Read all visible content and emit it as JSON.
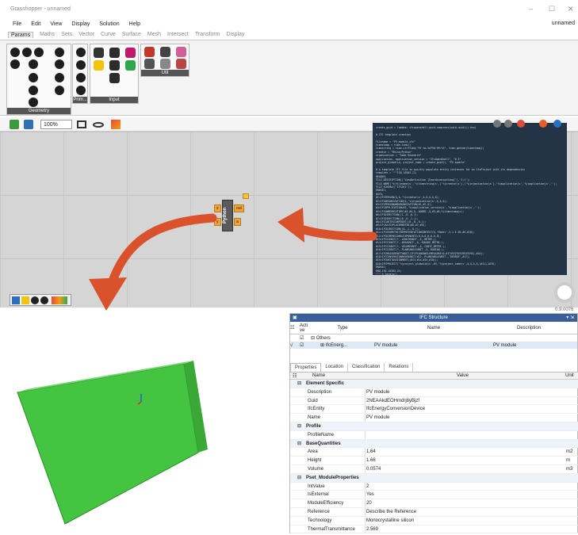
{
  "window": {
    "title": "Grasshopper - unnamed",
    "doc_name": "unnamed",
    "controls": [
      "–",
      "☐",
      "✕"
    ]
  },
  "menu": [
    "File",
    "Edit",
    "View",
    "Display",
    "Solution",
    "Help"
  ],
  "tabs": [
    "Params",
    "Maths",
    "Sets",
    "Vector",
    "Curve",
    "Surface",
    "Mesh",
    "Intersect",
    "Transform",
    "Display"
  ],
  "ribbon_groups": {
    "geometry": "Geometry",
    "primitive": "Prim...",
    "input": "Input",
    "util": "Util"
  },
  "canvas_toolbar": {
    "zoom": "100%"
  },
  "python_component": {
    "title": "Python",
    "inputs": [
      "x",
      "y"
    ],
    "outputs": [
      "out",
      "a"
    ]
  },
  "code_lines": [
    "create_guid = lambda: ifcopenshell.guid.compress(uuid.uuid1().hex)",
    "",
    "# IFC template creation",
    "",
    "filename = \"PV_module.ifc\"",
    "timestamp = time.time()",
    "timestring = time.strftime(\"%Y-%m-%dT%H:%M:%S\", time.gmtime(timestamp))",
    "creator = \"Rhino/Python\"",
    "organization = \"Some Research\"",
    "application, application_version = \"IfcOpenShell\", \"0.5\"",
    "project_globalid, project_name = create_guid(), \"PV module\"",
    "",
    "# A template IFC file to quickly populate entity instances for an IfcProject with its dependencies",
    "template = \"\"\"ISO-10303-21;",
    "HEADER;",
    "FILE_DESCRIPTION(('ViewDefinition [CoordinationView]'),'2;1');",
    "FILE_NAME('%(filename)s','%(timestring)s',('%(creator)s'),('%(organization)s'),'%(application)s','%(application)s','');",
    "FILE_SCHEMA(('IFC4X1'));",
    "ENDSEC;",
    "DATA;",
    "#1=IFCPERSON($,$,'%(creator)s',$,$,$,$,$);",
    "#2=IFCORGANIZATION($,'%(organization)s',$,$,$);",
    "#3=IFCPERSONANDORGANIZATION(#1,#2,$);",
    "#4=IFCAPPLICATION(#2,'%(application_version)s','%(application)s','');",
    "#5=IFCOWNERHISTORY(#3,#4,$,.ADDED.,$,#3,#4,%(timestamp)s);",
    "#6=IFCDIRECTION((1.,0.,0.));",
    "#7=IFCDIRECTION((0.,0.,1.));",
    "#8=IFCCARTESIANPOINT((0.,0.,0.));",
    "#9=IFCAXIS2PLACEMENT3D(#8,#7,#6);",
    "#10=IFCDIRECTION((0.,1.,0.));",
    "#11=IFCGEOMETRICREPRESENTATIONCONTEXT($,'Model',3,1.E-05,#9,#10);",
    "#12=IFCDIMENSIONALEXPONENTS(0,0,0,0,0,0,0);",
    "#13=IFCSIUNIT(*,.LENGTHUNIT.,$,.METRE.);",
    "#14=IFCSIUNIT(*,.AREAUNIT.,$,.SQUARE_METRE.);",
    "#15=IFCSIUNIT(*,.VOLUMEUNIT.,$,.CUBIC_METRE.);",
    "#16=IFCSIUNIT(*,.PLANEANGLEUNIT.,$,.RADIAN.);",
    "#17=IFCMEASUREWITHUNIT(IFCPLANEANGLEMEASURE(0.017453292519943295),#16);",
    "#18=IFCCONVERSIONBASEDUNIT(#12,.PLANEANGLEUNIT.,'DEGREE',#17);",
    "#19=IFCUNITASSIGNMENT((#13,#14,#15,#18));",
    "#20=IFCPROJECT('%(project_globalid)s',#5,'%(project_name)s',$,$,$,$,(#11),#19);",
    "ENDSEC;",
    "END-ISO-10303-21;",
    "\"\"\" % locals()"
  ],
  "coords": "0.9.0076",
  "ifc": {
    "header": "IFC Structure",
    "columns": {
      "active": "Acti ve",
      "type": "Type",
      "name": "Name",
      "description": "Description"
    },
    "rows": [
      {
        "type": "Others",
        "name": "",
        "description": ""
      },
      {
        "type": "IfcEnerg...",
        "name": "PV module",
        "description": "PV module"
      }
    ],
    "prop_tabs": [
      "Properties",
      "Location",
      "Classification",
      "Relations"
    ],
    "grid_head": {
      "name": "Name",
      "value": "Value",
      "unit": "Unit"
    },
    "groups": [
      {
        "name": "Element Specific",
        "props": [
          {
            "name": "Description",
            "value": "PV module",
            "unit": ""
          },
          {
            "name": "Guid",
            "value": "2NEAAkdEOHmdrj8yBjzf",
            "unit": ""
          },
          {
            "name": "IfcEntity",
            "value": "IfcEnergyConversionDevice",
            "unit": ""
          },
          {
            "name": "Name",
            "value": "PV module",
            "unit": ""
          }
        ]
      },
      {
        "name": "Profile",
        "props": [
          {
            "name": "ProfileName",
            "value": "",
            "unit": ""
          }
        ]
      },
      {
        "name": "BaseQuantities",
        "props": [
          {
            "name": "Area",
            "value": "1.64",
            "unit": "m2"
          },
          {
            "name": "Height",
            "value": "1.66",
            "unit": "m"
          },
          {
            "name": "Volume",
            "value": "0.0574",
            "unit": "m3"
          }
        ]
      },
      {
        "name": "Pset_ModuleProperties",
        "props": [
          {
            "name": "IntValue",
            "value": "2",
            "unit": ""
          },
          {
            "name": "IsExternal",
            "value": "Yes",
            "unit": ""
          },
          {
            "name": "ModuleEfficiency",
            "value": "20",
            "unit": ""
          },
          {
            "name": "Reference",
            "value": "Describe the Reference",
            "unit": ""
          },
          {
            "name": "Technology",
            "value": "Monocrystalline silicon",
            "unit": ""
          },
          {
            "name": "ThermalTransmittance",
            "value": "2.569",
            "unit": ""
          }
        ]
      }
    ]
  },
  "colors": {
    "arrow": "#d9522c",
    "panel": "#3ec43e",
    "code_bg": "#243447",
    "ifc_header": "#3a5f97"
  }
}
